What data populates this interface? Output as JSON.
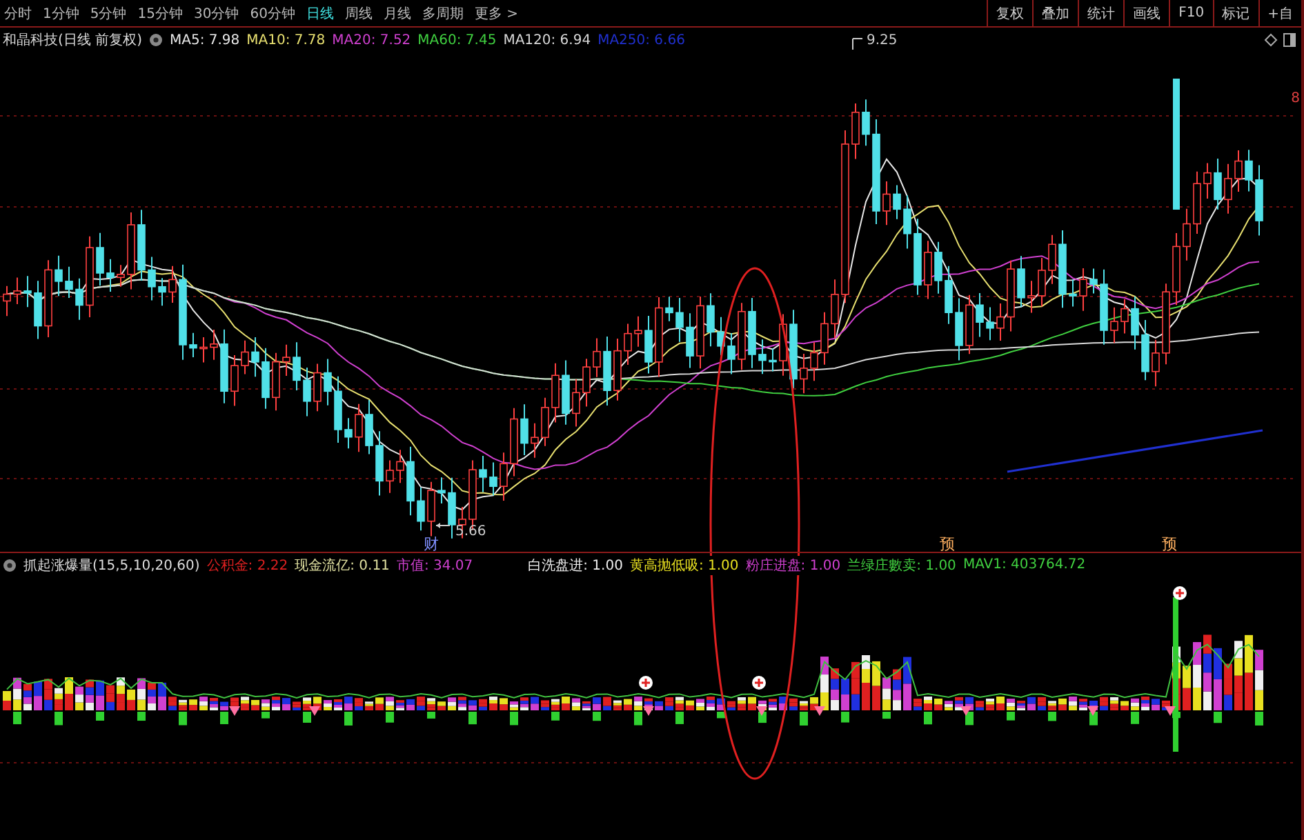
{
  "period_tabs": [
    {
      "label": "分时",
      "selected": false
    },
    {
      "label": "1分钟",
      "selected": false
    },
    {
      "label": "5分钟",
      "selected": false
    },
    {
      "label": "15分钟",
      "selected": false
    },
    {
      "label": "30分钟",
      "selected": false
    },
    {
      "label": "60分钟",
      "selected": false
    },
    {
      "label": "日线",
      "selected": true
    },
    {
      "label": "周线",
      "selected": false
    },
    {
      "label": "月线",
      "selected": false
    },
    {
      "label": "多周期",
      "selected": false
    },
    {
      "label": "更多 >",
      "selected": false
    }
  ],
  "toolbar_buttons": [
    "复权",
    "叠加",
    "统计",
    "画线",
    "F10",
    "标记",
    "+自"
  ],
  "main_chart": {
    "title": "和晶科技(日线 前复权)",
    "ma_legend": [
      {
        "label": "MA5: 7.98",
        "color": "#e8e8e8"
      },
      {
        "label": "MA10: 7.78",
        "color": "#e8e070"
      },
      {
        "label": "MA20: 7.52",
        "color": "#d040d0"
      },
      {
        "label": "MA60: 7.45",
        "color": "#40d040"
      },
      {
        "label": "MA120: 6.94",
        "color": "#d8d8d8"
      },
      {
        "label": "MA250: 6.66",
        "color": "#2030d0"
      }
    ],
    "high_label": "9.25",
    "low_label": "5.66",
    "axis_label": "8",
    "event_markers": [
      {
        "label": "财",
        "kind": "finance"
      },
      {
        "label": "预",
        "kind": "forecast"
      },
      {
        "label": "预",
        "kind": "forecast"
      }
    ]
  },
  "indicator": {
    "title": "抓起涨爆量(15,5,10,20,60)",
    "legend": [
      {
        "label": "公积金: 2.22",
        "color": "#e02020"
      },
      {
        "label": "现金流亿: 0.11",
        "color": "#e0e0a0"
      },
      {
        "label": "市值: 34.07",
        "color": "#d040d0"
      },
      {
        "label": "白洗盘进: 1.00",
        "color": "#f0f0f0"
      },
      {
        "label": "黄高抛低吸: 1.00",
        "color": "#e8e020"
      },
      {
        "label": "粉庄进盘: 1.00",
        "color": "#d040d0"
      },
      {
        "label": "兰绿庄數卖: 1.00",
        "color": "#40d040"
      },
      {
        "label": "MAV1: 403764.72",
        "color": "#40d040"
      }
    ]
  }
}
